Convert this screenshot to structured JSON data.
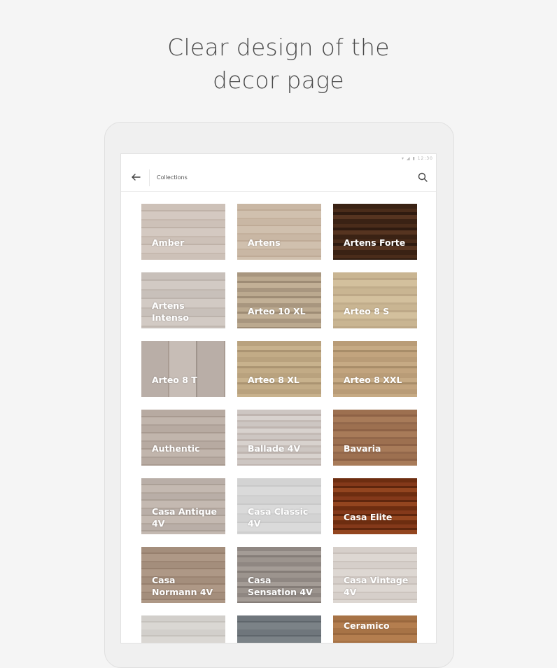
{
  "headline": {
    "line1": "Clear design of the",
    "line2": "decor page"
  },
  "statusbar": {
    "icons": "▾ ◢ ▮",
    "time": "12:30"
  },
  "appbar": {
    "back_icon": "arrow-left",
    "title": "Collections",
    "search_icon": "search"
  },
  "collections": [
    {
      "name": "Amber"
    },
    {
      "name": "Artens"
    },
    {
      "name": "Artens Forte"
    },
    {
      "name": "Artens Intenso"
    },
    {
      "name": "Arteo 10 XL"
    },
    {
      "name": "Arteo 8 S"
    },
    {
      "name": "Arteo 8 T"
    },
    {
      "name": "Arteo 8 XL"
    },
    {
      "name": "Arteo 8 XXL"
    },
    {
      "name": "Authentic"
    },
    {
      "name": "Ballade 4V"
    },
    {
      "name": "Bavaria"
    },
    {
      "name": "Casa Antique 4V"
    },
    {
      "name": "Casa Classic 4V"
    },
    {
      "name": "Casa Elite"
    },
    {
      "name": "Casa Normann 4V"
    },
    {
      "name": "Casa Sensation 4V"
    },
    {
      "name": "Casa Vintage 4V"
    },
    {
      "name": ""
    },
    {
      "name": ""
    },
    {
      "name": "Ceramico"
    }
  ]
}
